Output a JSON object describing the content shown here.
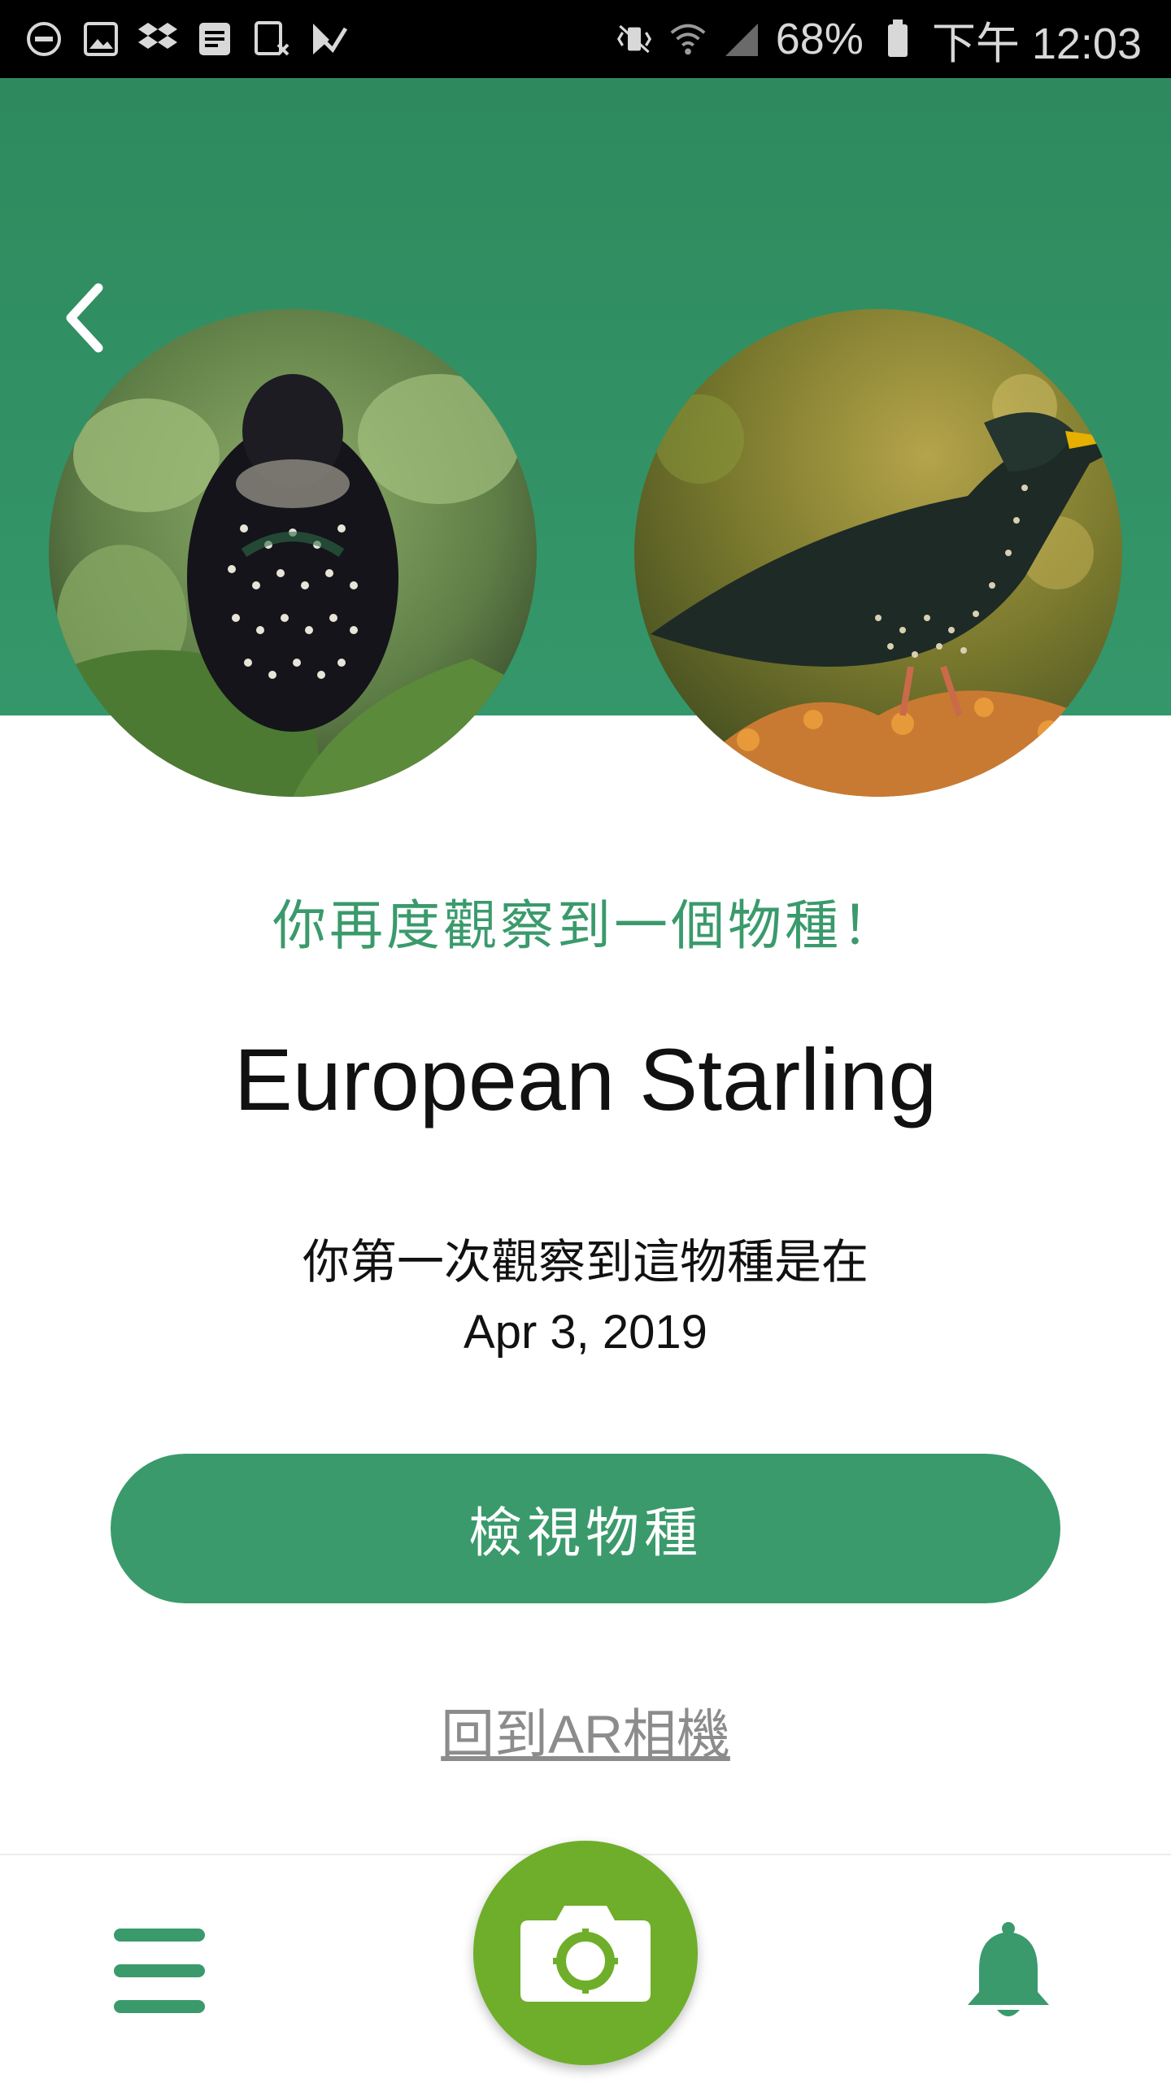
{
  "status_bar": {
    "battery": "68%",
    "time": "下午 12:03",
    "left_icons": [
      "do-not-disturb-icon",
      "gallery-icon",
      "dropbox-icon",
      "notes-icon",
      "keyboard-icon",
      "app-icon"
    ],
    "right_icons": [
      "vibrate-icon",
      "wifi-icon",
      "signal-icon",
      "battery-icon"
    ]
  },
  "header": {
    "back_icon": "chevron-left-icon",
    "photos": [
      "starling-front-photo",
      "starling-side-photo"
    ]
  },
  "content": {
    "subtitle": "你再度觀察到一個物種！",
    "species_name": "European Starling",
    "first_observed_label": "你第一次觀察到這物種是在",
    "first_observed_date": "Apr 3, 2019",
    "view_species_button": "檢視物種",
    "back_to_camera_link": "回到AR相機"
  },
  "bottom_nav": {
    "menu_icon": "menu-icon",
    "camera_icon": "camera-icon",
    "notification_icon": "bell-icon"
  },
  "colors": {
    "header_green": "#2e8a5e",
    "accent_green": "#3a9a6c",
    "camera_green": "#6fae2a"
  }
}
